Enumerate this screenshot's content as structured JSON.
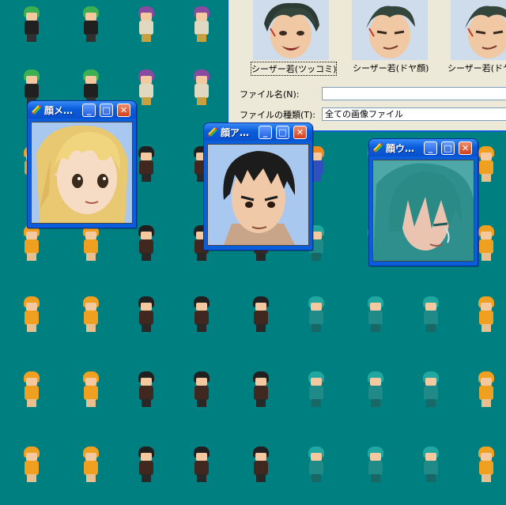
{
  "windows": {
    "face_me": {
      "title": "顔メ…",
      "buttons": {
        "min": "_",
        "max": "□",
        "close": "✕"
      }
    },
    "face_a": {
      "title": "顔ア…",
      "buttons": {
        "min": "_",
        "max": "□",
        "close": "✕"
      }
    },
    "face_u": {
      "title": "顔ウ…",
      "buttons": {
        "min": "_",
        "max": "□",
        "close": "✕"
      }
    }
  },
  "file_dialog": {
    "thumbnails": [
      {
        "label": "シーザー若(ツッコミ)",
        "selected": true
      },
      {
        "label": "シーザー若(ドヤ顔)",
        "selected": false
      },
      {
        "label": "シーザー若(ドヤ"
      }
    ],
    "filename_label": "ファイル名(N):",
    "filename_value": "",
    "filetype_label": "ファイルの種類(T):",
    "filetype_value": "全ての画像ファイル"
  },
  "icons": {
    "app_icon": "paint-palette-icon",
    "minimize": "minimize-icon",
    "maximize": "maximize-icon",
    "close": "close-icon"
  },
  "colors": {
    "background": "#007f80",
    "titlebar": "#0a5ddb",
    "close_button": "#d3411b"
  }
}
